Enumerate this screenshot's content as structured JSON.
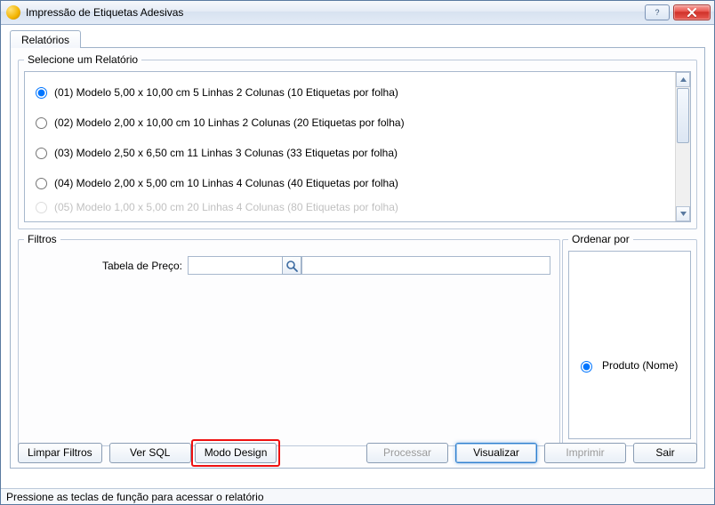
{
  "window": {
    "title": "Impressão de Etiquetas Adesivas"
  },
  "tabs": {
    "report": "Relatórios"
  },
  "report_select": {
    "legend": "Selecione um Relatório",
    "items": [
      "(01) Modelo 5,00 x 10,00 cm 5 Linhas 2 Colunas (10 Etiquetas por folha)",
      "(02) Modelo 2,00 x 10,00 cm 10 Linhas 2 Colunas (20 Etiquetas por folha)",
      "(03) Modelo 2,50 x 6,50 cm 11 Linhas 3 Colunas (33 Etiquetas por folha)",
      "(04) Modelo 2,00 x 5,00 cm 10 Linhas 4 Colunas (40 Etiquetas por folha)",
      "(05) Modelo 1,00 x 5,00 cm 20 Linhas 4 Colunas (80 Etiquetas por folha)"
    ],
    "selected_index": 0
  },
  "filters": {
    "legend": "Filtros",
    "price_table_label": "Tabela de Preço:",
    "price_table_code": "",
    "price_table_name": ""
  },
  "order": {
    "legend": "Ordenar por",
    "options": [
      "Produto (Nome)"
    ],
    "selected_index": 0
  },
  "buttons": {
    "clear_filters": "Limpar Filtros",
    "view_sql": "Ver SQL",
    "design_mode": "Modo Design",
    "process": "Processar",
    "preview": "Visualizar",
    "print": "Imprimir",
    "exit": "Sair"
  },
  "statusbar": "Pressione as teclas de função para acessar o relatório"
}
